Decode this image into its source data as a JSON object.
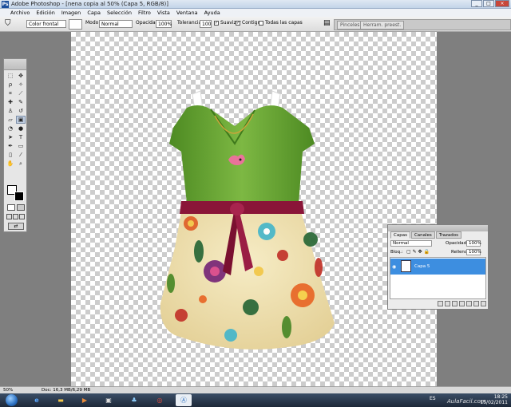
{
  "window": {
    "title": "Adobe Photoshop - [nena copia al 50% (Capa 5, RGB/8)]",
    "app_icon": "Ps",
    "min": "_",
    "max": "□",
    "close": "×"
  },
  "menu": [
    "Archivo",
    "Edición",
    "Imagen",
    "Capa",
    "Selección",
    "Filtro",
    "Vista",
    "Ventana",
    "Ayuda"
  ],
  "options": {
    "tool_preset": "Color frontal",
    "mode_label": "Modo:",
    "mode_value": "Normal",
    "opacity_label": "Opacidad:",
    "opacity_value": "100%",
    "tolerance_label": "Tolerancia:",
    "tolerance_value": "100",
    "smooth_label": "Suavizar",
    "contiguous_label": "Contiguo",
    "all_layers_label": "Todas las capas"
  },
  "palette_well": [
    "Pinceles",
    "Herram. preest."
  ],
  "status": {
    "zoom": "50%",
    "doc": "Doc: 16,3 MB/6,29 MB"
  },
  "layers_panel": {
    "tabs": [
      "Capas",
      "Canales",
      "Trazados"
    ],
    "active_tab": "Capas",
    "blend_mode": "Normal",
    "opacity_label": "Opacidad:",
    "opacity_value": "100%",
    "lock_label": "Bloq.:",
    "fill_label": "Relleno:",
    "fill_value": "100%",
    "layer_name": "Capa 5"
  },
  "taskbar": {
    "language": "ES",
    "time": "18:25",
    "date": "15/02/2011",
    "watermark": "AulaFacil.com"
  }
}
